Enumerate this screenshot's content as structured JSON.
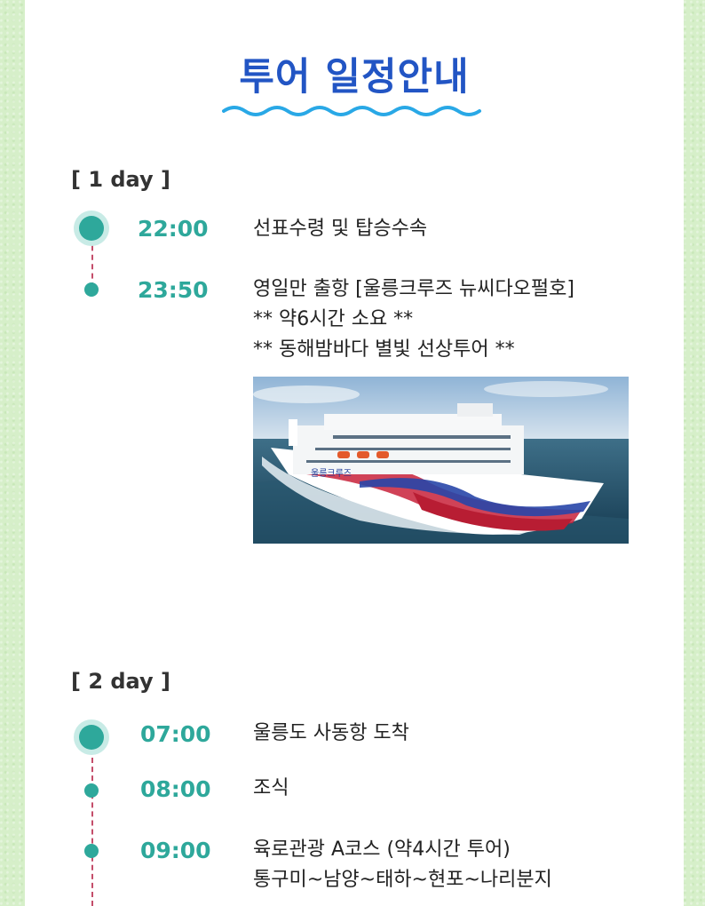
{
  "title": "투어 일정안내",
  "day1": {
    "label": "[ 1 day ]",
    "items": [
      {
        "time": "22:00",
        "lines": [
          "선표수령 및 탑승수속"
        ]
      },
      {
        "time": "23:50",
        "lines": [
          "영일만 출항 [울릉크루즈 뉴씨다오펄호]",
          "** 약6시간 소요 **",
          "** 동해밤바다 별빛 선상투어 **"
        ]
      }
    ],
    "ship_text": "울릉크루즈"
  },
  "day2": {
    "label": "[ 2 day ]",
    "items": [
      {
        "time": "07:00",
        "lines": [
          "울릉도 사동항 도착"
        ]
      },
      {
        "time": "08:00",
        "lines": [
          "조식"
        ]
      },
      {
        "time": "09:00",
        "lines": [
          "육로관광 A코스 (약4시간 투어)",
          "통구미~남양~태하~현포~나리분지"
        ]
      }
    ]
  }
}
